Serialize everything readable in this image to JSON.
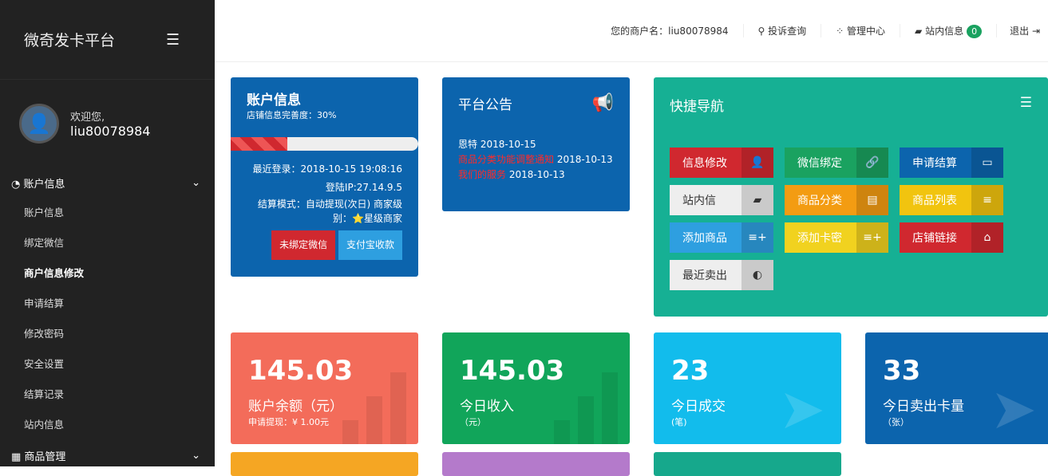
{
  "brand": "微奇发卡平台",
  "user": {
    "welcome": "欢迎您,",
    "name": "liu80078984"
  },
  "sidebar": {
    "group1": "账户信息",
    "items": [
      "账户信息",
      "绑定微信",
      "商户信息修改",
      "申请结算",
      "修改密码",
      "安全设置",
      "结算记录",
      "站内信息"
    ],
    "group2": "商品管理"
  },
  "topbar": {
    "merchant": "您的商户名：liu80078984",
    "complaint": "投诉查询",
    "admin": "管理中心",
    "messages": "站内信息",
    "message_count": "0",
    "logout": "退出"
  },
  "account": {
    "title": "账户信息",
    "completeness": "店铺信息完善度：30%",
    "progress": 30,
    "last_login": "最近登录：2018-10-15 19:08:16",
    "ip": "登陆IP:27.14.9.5",
    "mode": "结算模式：自动提现(次日) 商家级别：",
    "level": "星级商家",
    "btn_wechat": "未绑定微信",
    "btn_alipay": "支付宝收款"
  },
  "notice": {
    "title": "平台公告",
    "items": [
      {
        "t": "恩特",
        "d": "2018-10-15",
        "red": false
      },
      {
        "t": "商品分类功能调整通知",
        "d": "2018-10-13",
        "red": true
      },
      {
        "t": "我们的服务",
        "d": "2018-10-13",
        "red": true
      }
    ]
  },
  "quick": {
    "title": "快捷导航",
    "items": [
      {
        "label": "信息修改",
        "icon": "👤",
        "bg": "#d0282f"
      },
      {
        "label": "微信绑定",
        "icon": "🔗",
        "bg": "#1aa260"
      },
      {
        "label": "申请结算",
        "icon": "▭",
        "bg": "#0c64ad"
      },
      {
        "label": "站内信",
        "icon": "▰",
        "bg": "#eeeeee"
      },
      {
        "label": "商品分类",
        "icon": "▤",
        "bg": "#f39c12"
      },
      {
        "label": "商品列表",
        "icon": "≡",
        "bg": "#f1c40f"
      },
      {
        "label": "添加商品",
        "icon": "≡+",
        "bg": "#2e9fe0"
      },
      {
        "label": "添加卡密",
        "icon": "≡+",
        "bg": "#f1d21f"
      },
      {
        "label": "店铺链接",
        "icon": "⌂",
        "bg": "#d0282f"
      },
      {
        "label": "最近卖出",
        "icon": "◐",
        "bg": "#eeeeee"
      }
    ]
  },
  "stats": [
    {
      "value": "145.03",
      "label": "账户余额（元）",
      "sub": "申请提现：¥ 1.00元",
      "bg": "#f36c5a"
    },
    {
      "value": "145.03",
      "label": "今日收入",
      "sub": "（元）",
      "bg": "#11a55a"
    },
    {
      "value": "23",
      "label": "今日成交",
      "sub": "(笔)",
      "bg": "#12bcec"
    },
    {
      "value": "33",
      "label": "今日卖出卡量",
      "sub": "（张）",
      "bg": "#0c64ad"
    }
  ]
}
